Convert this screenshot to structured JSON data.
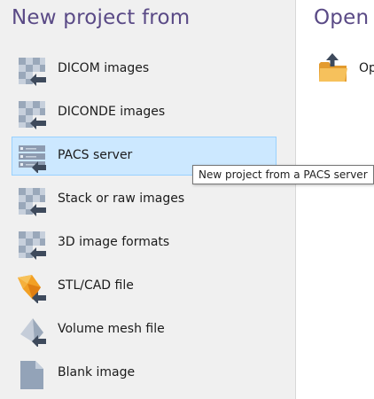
{
  "left_panel": {
    "title": "New project from",
    "items": [
      {
        "label": "DICOM images",
        "icon": "dicom-import-icon"
      },
      {
        "label": "DICONDE images",
        "icon": "diconde-import-icon"
      },
      {
        "label": "PACS server",
        "icon": "pacs-server-icon",
        "selected": true
      },
      {
        "label": "Stack or raw images",
        "icon": "stack-import-icon"
      },
      {
        "label": "3D image formats",
        "icon": "3d-image-import-icon"
      },
      {
        "label": "STL/CAD file",
        "icon": "stl-cad-icon"
      },
      {
        "label": "Volume mesh file",
        "icon": "volume-mesh-icon"
      },
      {
        "label": "Blank image",
        "icon": "blank-image-icon"
      }
    ]
  },
  "tooltip": {
    "text": "New project from a PACS server"
  },
  "right_panel": {
    "title": "Open p",
    "items": [
      {
        "label": "Op",
        "icon": "open-folder-icon"
      }
    ]
  },
  "colors": {
    "title": "#5a4a86",
    "selected_bg": "#cce8ff",
    "selected_border": "#99d1ff",
    "panel_bg": "#f0f0f0"
  }
}
